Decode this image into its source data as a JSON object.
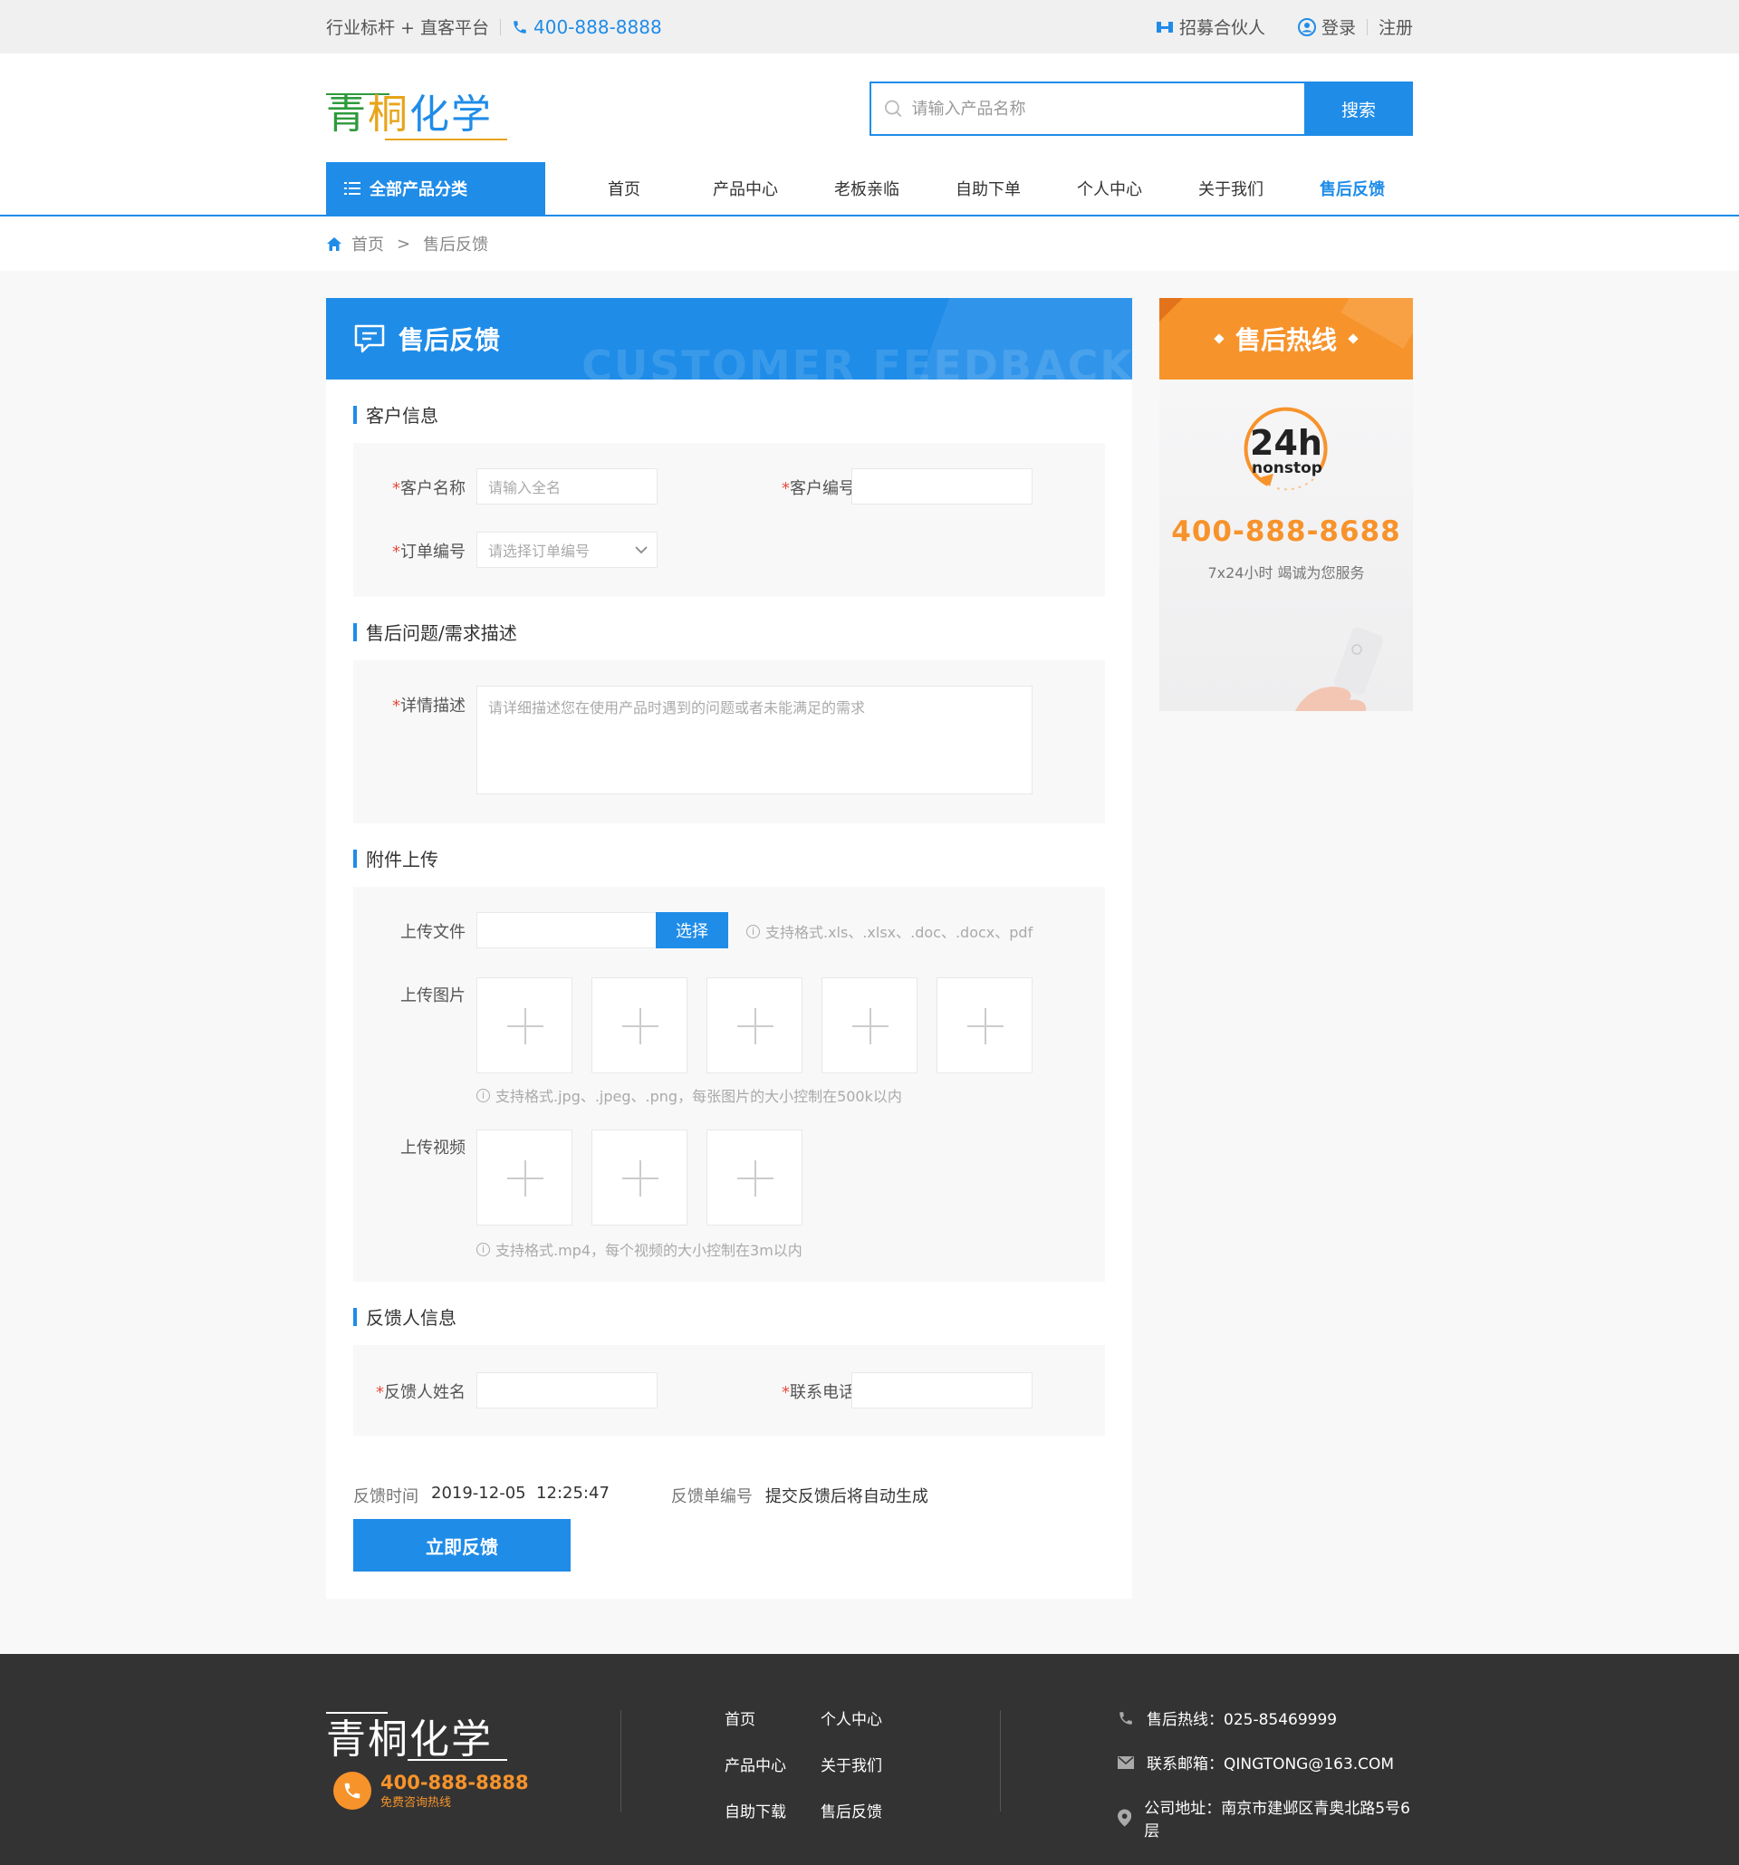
{
  "topbar": {
    "slogan": "行业标杆 + 直客平台",
    "phone": "400-888-8888",
    "partner": "招募合伙人",
    "login": "登录",
    "register": "注册"
  },
  "header": {
    "logo": {
      "c1": "青",
      "c2": "桐",
      "c3": "化学"
    },
    "search_placeholder": "请输入产品名称",
    "search_button": "搜索"
  },
  "nav": {
    "all_categories": "全部产品分类",
    "items": [
      "首页",
      "产品中心",
      "老板亲临",
      "自助下单",
      "个人中心",
      "关于我们",
      "售后反馈"
    ],
    "active_index": 6
  },
  "breadcrumb": {
    "home": "首页",
    "separator": ">",
    "current": "售后反馈"
  },
  "panel": {
    "title": "售后反馈",
    "title_en": "CUSTOMER FEEDBACK",
    "sections": {
      "customer": "客户信息",
      "issue": "售后问题/需求描述",
      "upload": "附件上传",
      "feedbacker": "反馈人信息"
    },
    "fields": {
      "customer_name": {
        "label": "客户名称",
        "placeholder": "请输入全名"
      },
      "customer_no": {
        "label": "客户编号",
        "value": ""
      },
      "order_no": {
        "label": "订单编号",
        "placeholder": "请选择订单编号"
      },
      "detail": {
        "label": "详情描述",
        "placeholder": "请详细描述您在使用产品时遇到的问题或者未能满足的需求"
      },
      "upload_file": {
        "label": "上传文件",
        "button": "选择",
        "hint": "支持格式.xls、.xlsx、.doc、.docx、pdf"
      },
      "upload_image": {
        "label": "上传图片",
        "hint": "支持格式.jpg、.jpeg、.png，每张图片的大小控制在500k以内"
      },
      "upload_video": {
        "label": "上传视频",
        "hint": "支持格式.mp4，每个视频的大小控制在3m以内"
      },
      "feedbacker_name": {
        "label": "反馈人姓名"
      },
      "contact_phone": {
        "label": "联系电话"
      }
    },
    "required_mark": "*",
    "meta": {
      "time_label": "反馈时间",
      "time_value": "2019-12-05  12:25:47",
      "no_label": "反馈单编号",
      "no_value": "提交反馈后将自动生成"
    },
    "submit": "立即反馈"
  },
  "side": {
    "title": "售后热线",
    "clock_big": "24h",
    "clock_small": "nonstop",
    "phone": "400-888-8688",
    "sub": "7x24小时 竭诚为您服务"
  },
  "footer": {
    "logo": "青桐化学",
    "hotline": "400-888-8888",
    "hotline_sub": "免费咨询热线",
    "links": [
      "首页",
      "个人中心",
      "产品中心",
      "关于我们",
      "自助下载",
      "售后反馈"
    ],
    "contact": {
      "hotline": "售后热线：025-85469999",
      "email": "联系邮箱：QINGTONG@163.COM",
      "address": "公司地址：南京市建邺区青奥北路5号6层"
    }
  },
  "colors": {
    "primary": "#1f8ce8",
    "accent": "#f7932b",
    "required": "#e64b3b",
    "footer_bg": "#333333"
  }
}
